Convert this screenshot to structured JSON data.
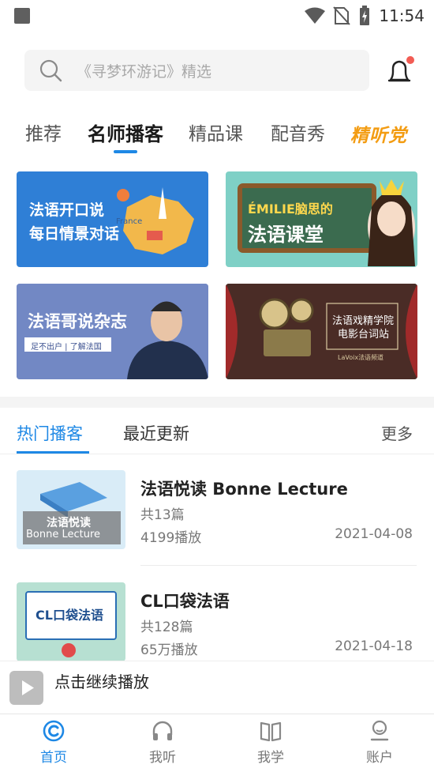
{
  "status_bar": {
    "time": "11:54"
  },
  "search": {
    "placeholder": "《寻梦环游记》精选"
  },
  "category_tabs": [
    {
      "label": "推荐"
    },
    {
      "label": "名师播客"
    },
    {
      "label": "精品课"
    },
    {
      "label": "配音秀"
    },
    {
      "label": "精听党"
    }
  ],
  "banners": [
    {
      "line1": "法语开口说",
      "line2": "每日情景对话",
      "tag": "France"
    },
    {
      "line1": "ÉMILIE脑思的",
      "line2": "法语课堂"
    },
    {
      "line1": "法语哥说杂志",
      "line2": "足不出户 | 了解法国"
    },
    {
      "line1": "法语戏精学院",
      "line2": "电影台词站",
      "tag": "LaVoix法语频道"
    }
  ],
  "section_tabs": {
    "tab1": "热门播客",
    "tab2": "最近更新",
    "more": "更多"
  },
  "podcasts": [
    {
      "title": "法语悦读 Bonne Lecture",
      "count": "共13篇",
      "plays": "4199播放",
      "date": "2021-04-08",
      "thumb_line1": "法语悦读",
      "thumb_line2": "Bonne Lecture"
    },
    {
      "title": "CL口袋法语",
      "count": "共128篇",
      "plays": "65万播放",
      "date": "2021-04-18",
      "thumb_line1": "CL口袋法语"
    }
  ],
  "mini_player": {
    "label": "点击继续播放"
  },
  "bottom_nav": [
    {
      "label": "首页"
    },
    {
      "label": "我听"
    },
    {
      "label": "我学"
    },
    {
      "label": "账户"
    }
  ],
  "colors": {
    "accent": "#1e88e5",
    "notification": "#f25c54",
    "special_tab": "#f39c12"
  }
}
